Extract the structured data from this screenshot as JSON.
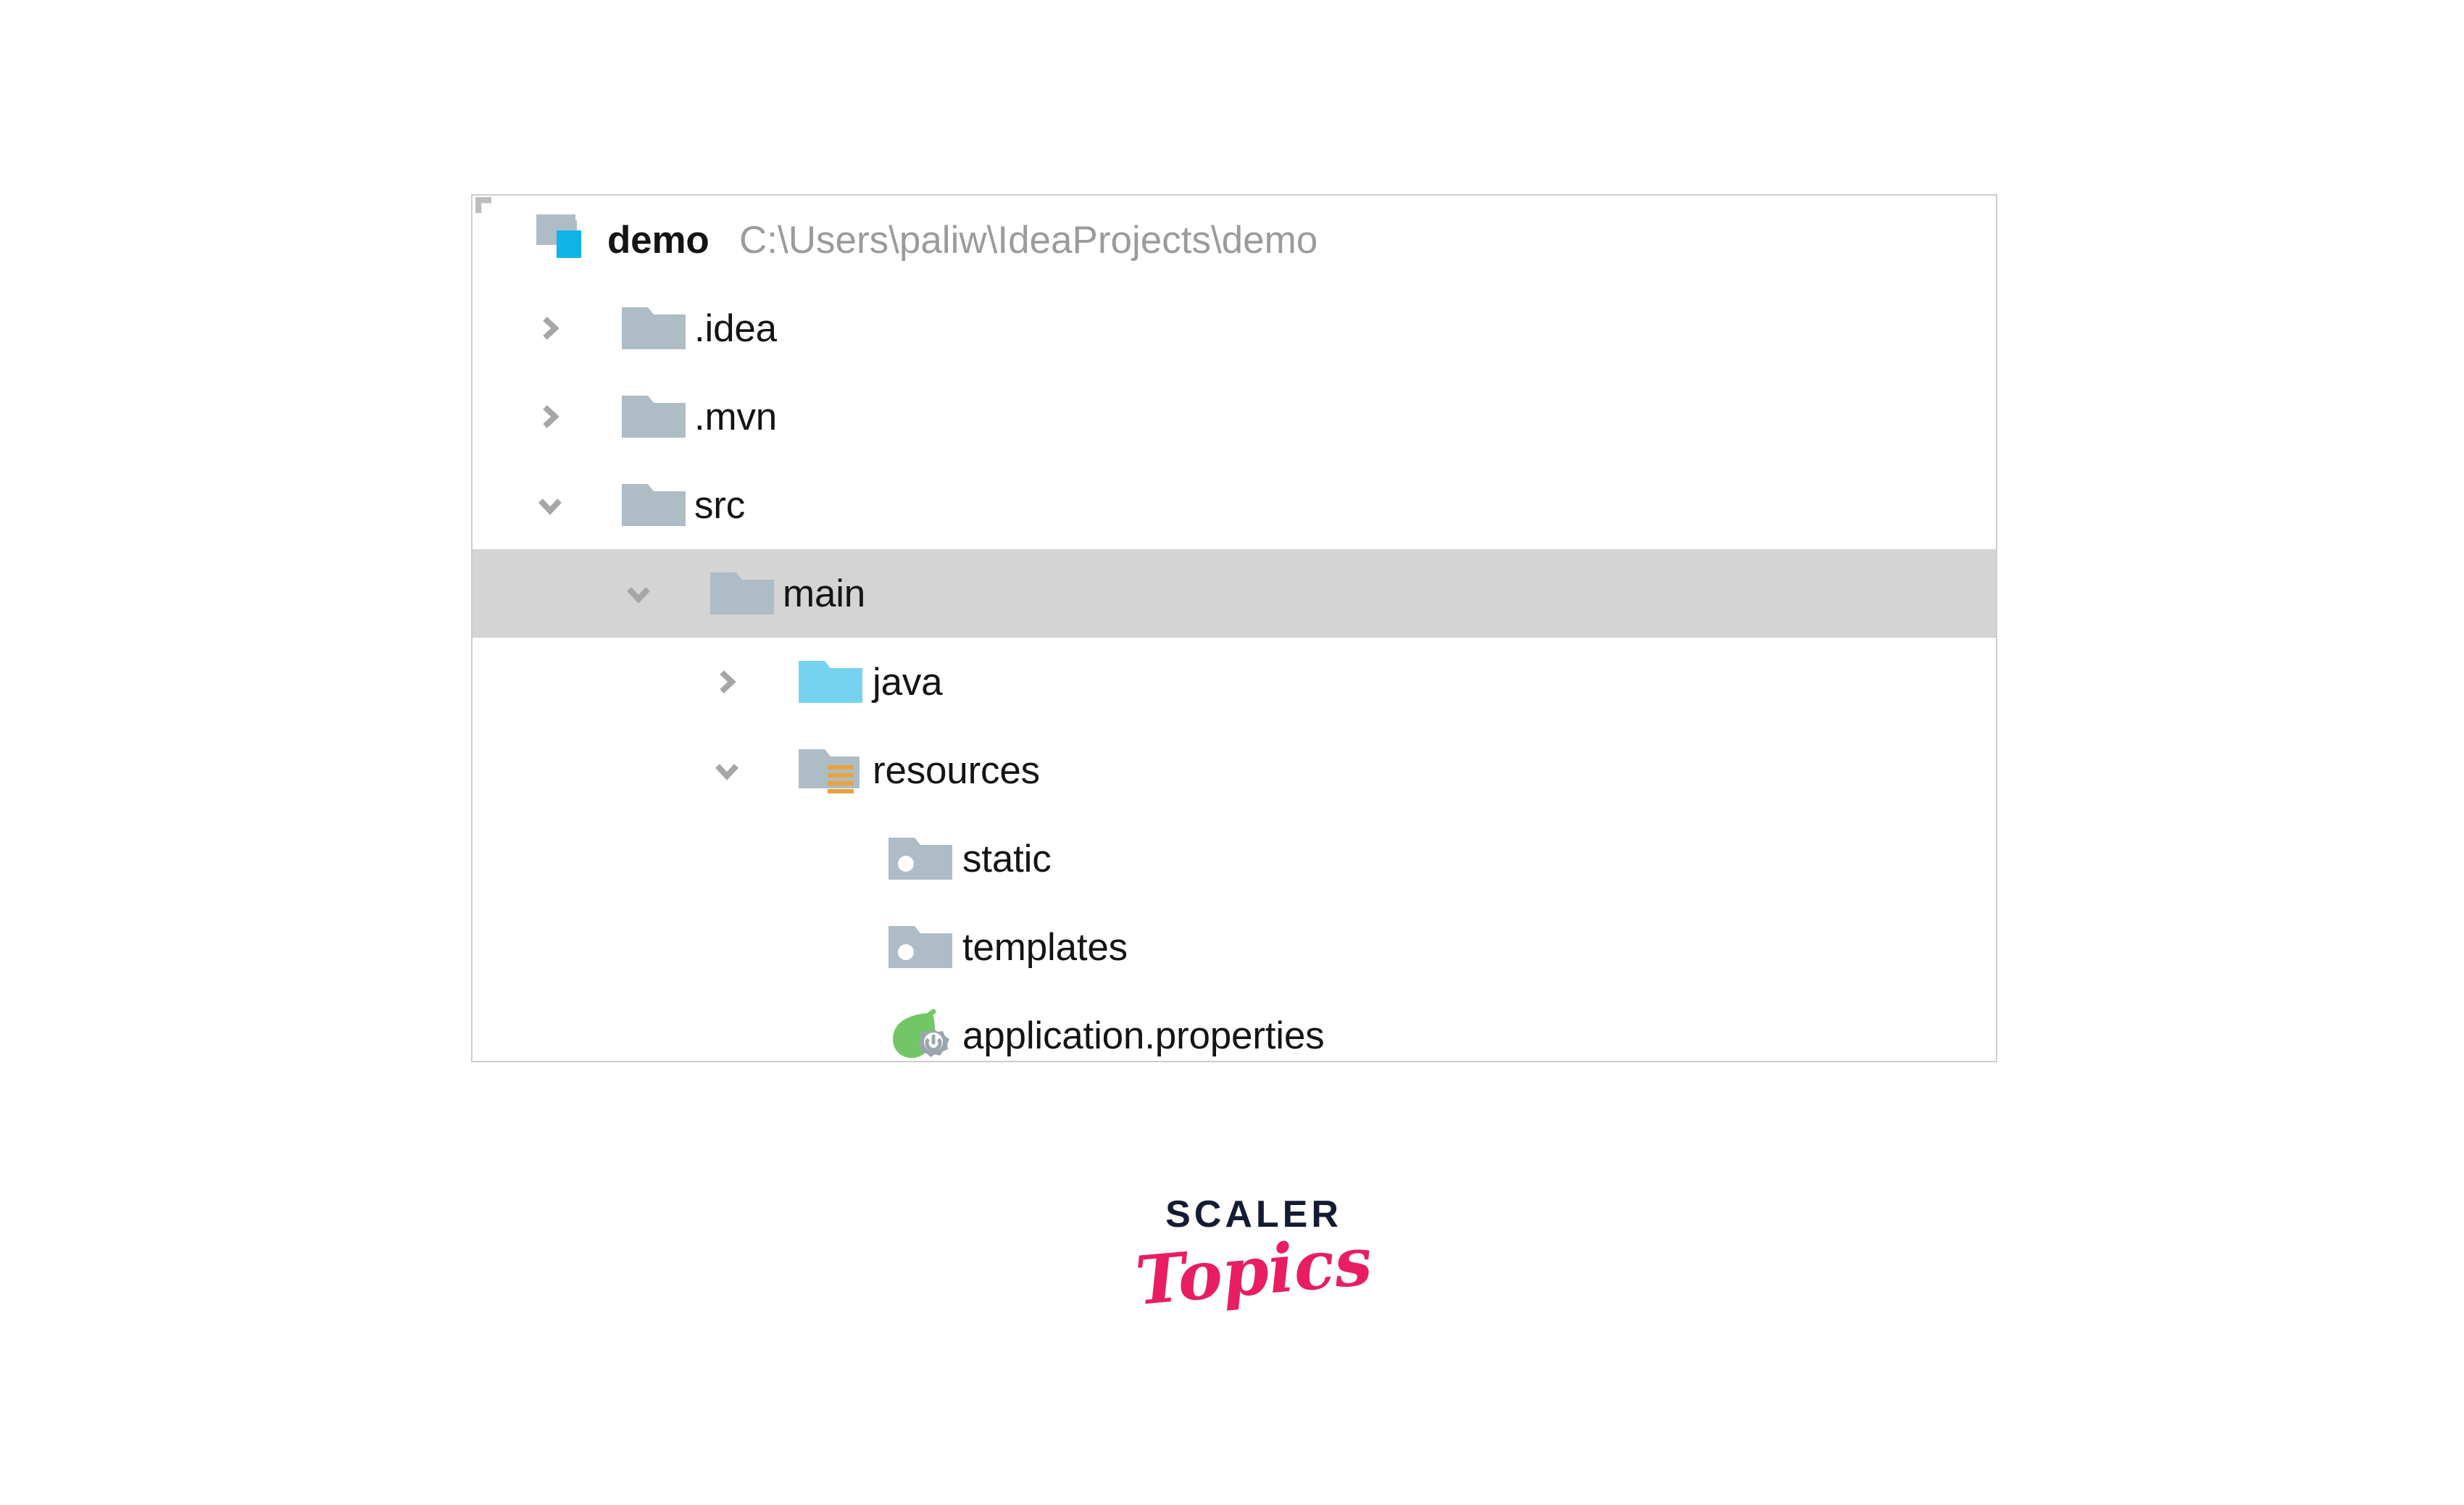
{
  "panel": {
    "name": "project-tool-window",
    "background": "#ffffff",
    "border_color": "#cdcdcd",
    "selection_color": "#d4d4d4"
  },
  "colors": {
    "folder_gray": "#aebcc6",
    "folder_cyan": "#75d3f0",
    "module_badge_cyan": "#10b5e8",
    "resources_badge_orange": "#e8a33d",
    "spring_leaf_green": "#73c666",
    "gear_gray": "#9aa6ae",
    "text": "#141414",
    "path_text": "#9b9b9b",
    "brand_navy": "#141b33",
    "brand_pink": "#e81d62"
  },
  "tree": {
    "nodes": [
      {
        "label": "demo",
        "secondary": "C:\\Users\\paliw\\IdeaProjects\\demo",
        "depth": 0,
        "icon": "module-folder-icon",
        "toggle": "none",
        "bold": true,
        "selected": false
      },
      {
        "label": ".idea",
        "secondary": "",
        "depth": 1,
        "icon": "folder-icon",
        "toggle": "chevron-right-icon",
        "bold": false,
        "selected": false
      },
      {
        "label": ".mvn",
        "secondary": "",
        "depth": 1,
        "icon": "folder-icon",
        "toggle": "chevron-right-icon",
        "bold": false,
        "selected": false
      },
      {
        "label": "src",
        "secondary": "",
        "depth": 1,
        "icon": "folder-icon",
        "toggle": "chevron-down-icon",
        "bold": false,
        "selected": false
      },
      {
        "label": "main",
        "secondary": "",
        "depth": 2,
        "icon": "folder-icon",
        "toggle": "chevron-down-icon",
        "bold": false,
        "selected": true
      },
      {
        "label": "java",
        "secondary": "",
        "depth": 3,
        "icon": "sources-root-folder-icon",
        "toggle": "chevron-right-icon",
        "bold": false,
        "selected": false
      },
      {
        "label": "resources",
        "secondary": "",
        "depth": 3,
        "icon": "resources-root-folder-icon",
        "toggle": "chevron-down-icon",
        "bold": false,
        "selected": false
      },
      {
        "label": "static",
        "secondary": "",
        "depth": 4,
        "icon": "empty-folder-icon",
        "toggle": "none",
        "bold": false,
        "selected": false
      },
      {
        "label": "templates",
        "secondary": "",
        "depth": 4,
        "icon": "empty-folder-icon",
        "toggle": "none",
        "bold": false,
        "selected": false
      },
      {
        "label": "application.properties",
        "secondary": "",
        "depth": 4,
        "icon": "spring-properties-file-icon",
        "toggle": "none",
        "bold": false,
        "selected": false
      }
    ]
  },
  "brand": {
    "wordmark": "SCALER",
    "script": "Topics"
  }
}
